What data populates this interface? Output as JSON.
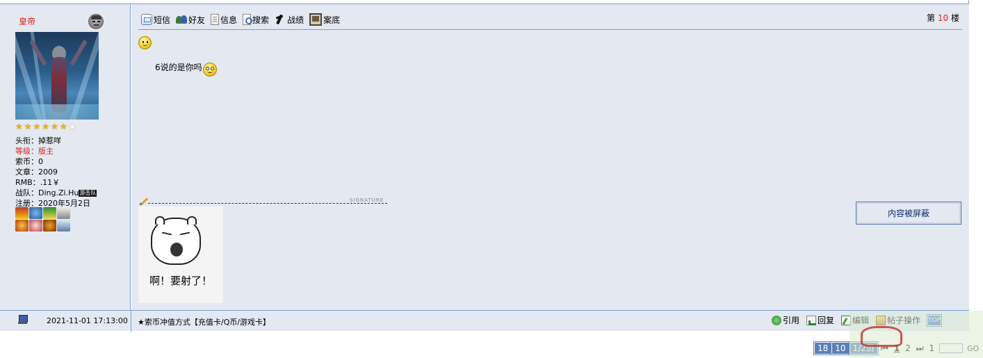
{
  "author": {
    "name": "皇帝",
    "stars_filled": 6,
    "stars_total": 7,
    "info": [
      {
        "label": "头衔：",
        "value": "掉惹咩",
        "red": false
      },
      {
        "label": "等级：",
        "value": "版主",
        "red": true
      },
      {
        "label": "索币：",
        "value": "0",
        "red": false
      },
      {
        "label": "文章：",
        "value": "2009",
        "red": false
      },
      {
        "label": "RMB：",
        "value": ".11￥",
        "red": false
      },
      {
        "label": "战队：",
        "value": "Ding.Zi.Hu",
        "red": false
      },
      {
        "label": "注册：",
        "value": "2020年5月2日",
        "red": false
      }
    ],
    "team_tag": "游击队"
  },
  "toolbar": {
    "items": [
      {
        "label": "短信",
        "icon": "message-icon"
      },
      {
        "label": "好友",
        "icon": "friends-icon"
      },
      {
        "label": "信息",
        "icon": "info-icon"
      },
      {
        "label": "搜索",
        "icon": "search-icon"
      },
      {
        "label": "战绩",
        "icon": "record-icon"
      },
      {
        "label": "案底",
        "icon": "case-icon"
      }
    ]
  },
  "floor": {
    "prefix": "第",
    "number": "10",
    "suffix": "楼"
  },
  "post": {
    "text": "6说的是你吗",
    "signature_label": "SIGNATURE",
    "signature_caption": "啊！要射了！",
    "blocked_text": "内容被屏蔽"
  },
  "footer": {
    "time": "2021-11-01 17:13:00",
    "recharge": "★索币冲值方式【充值卡/Q币/游戏卡】",
    "actions": [
      {
        "label": "引用",
        "icon": "quote-icon"
      },
      {
        "label": "回复",
        "icon": "reply-icon"
      },
      {
        "label": "编辑",
        "icon": "edit-icon"
      },
      {
        "label": "帖子操作",
        "icon": "post-ops-icon"
      }
    ],
    "top_label": "TOP"
  },
  "pager": {
    "total": "18",
    "per_page": "10",
    "page_info": "1/2页",
    "first": "⏮",
    "pages": [
      "1",
      "2"
    ],
    "last": "⏭",
    "jump_value": "1",
    "go": "GO"
  },
  "colors": {
    "accent": "#7a9fd4",
    "background": "#e3e8f1",
    "red": "#e0201a"
  }
}
